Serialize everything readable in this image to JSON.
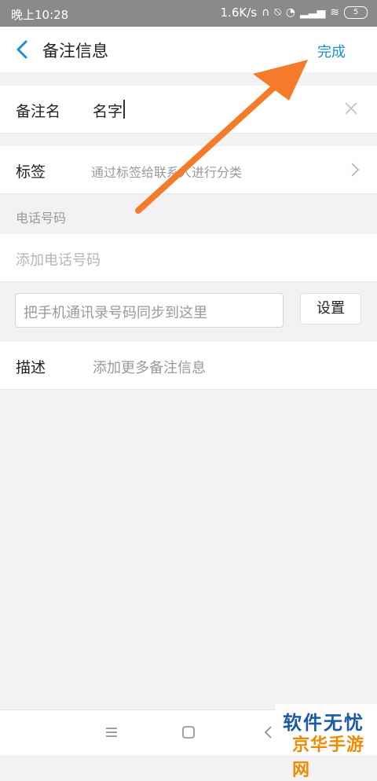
{
  "status_bar": {
    "time": "晚上10:28",
    "speed": "1.6K/s",
    "battery": "5"
  },
  "header": {
    "title": "备注信息",
    "done_label": "完成"
  },
  "remark_name": {
    "label": "备注名",
    "value": "名字"
  },
  "tags": {
    "label": "标签",
    "placeholder": "通过标签给联系人进行分类"
  },
  "phone": {
    "section_title": "电话号码",
    "add_placeholder": "添加电话号码",
    "sync_placeholder": "把手机通讯录号码同步到这里",
    "settings_label": "设置"
  },
  "description": {
    "label": "描述",
    "placeholder": "添加更多备注信息"
  },
  "watermark": {
    "line1": "软件无忧",
    "line2": "京华手游网"
  },
  "colors": {
    "accent": "#1e8fd6",
    "arrow": "#f47b2a"
  },
  "icons": [
    "back-arrow-icon",
    "clear-icon",
    "chevron-right-icon",
    "menu-icon",
    "home-icon",
    "back-nav-icon"
  ]
}
